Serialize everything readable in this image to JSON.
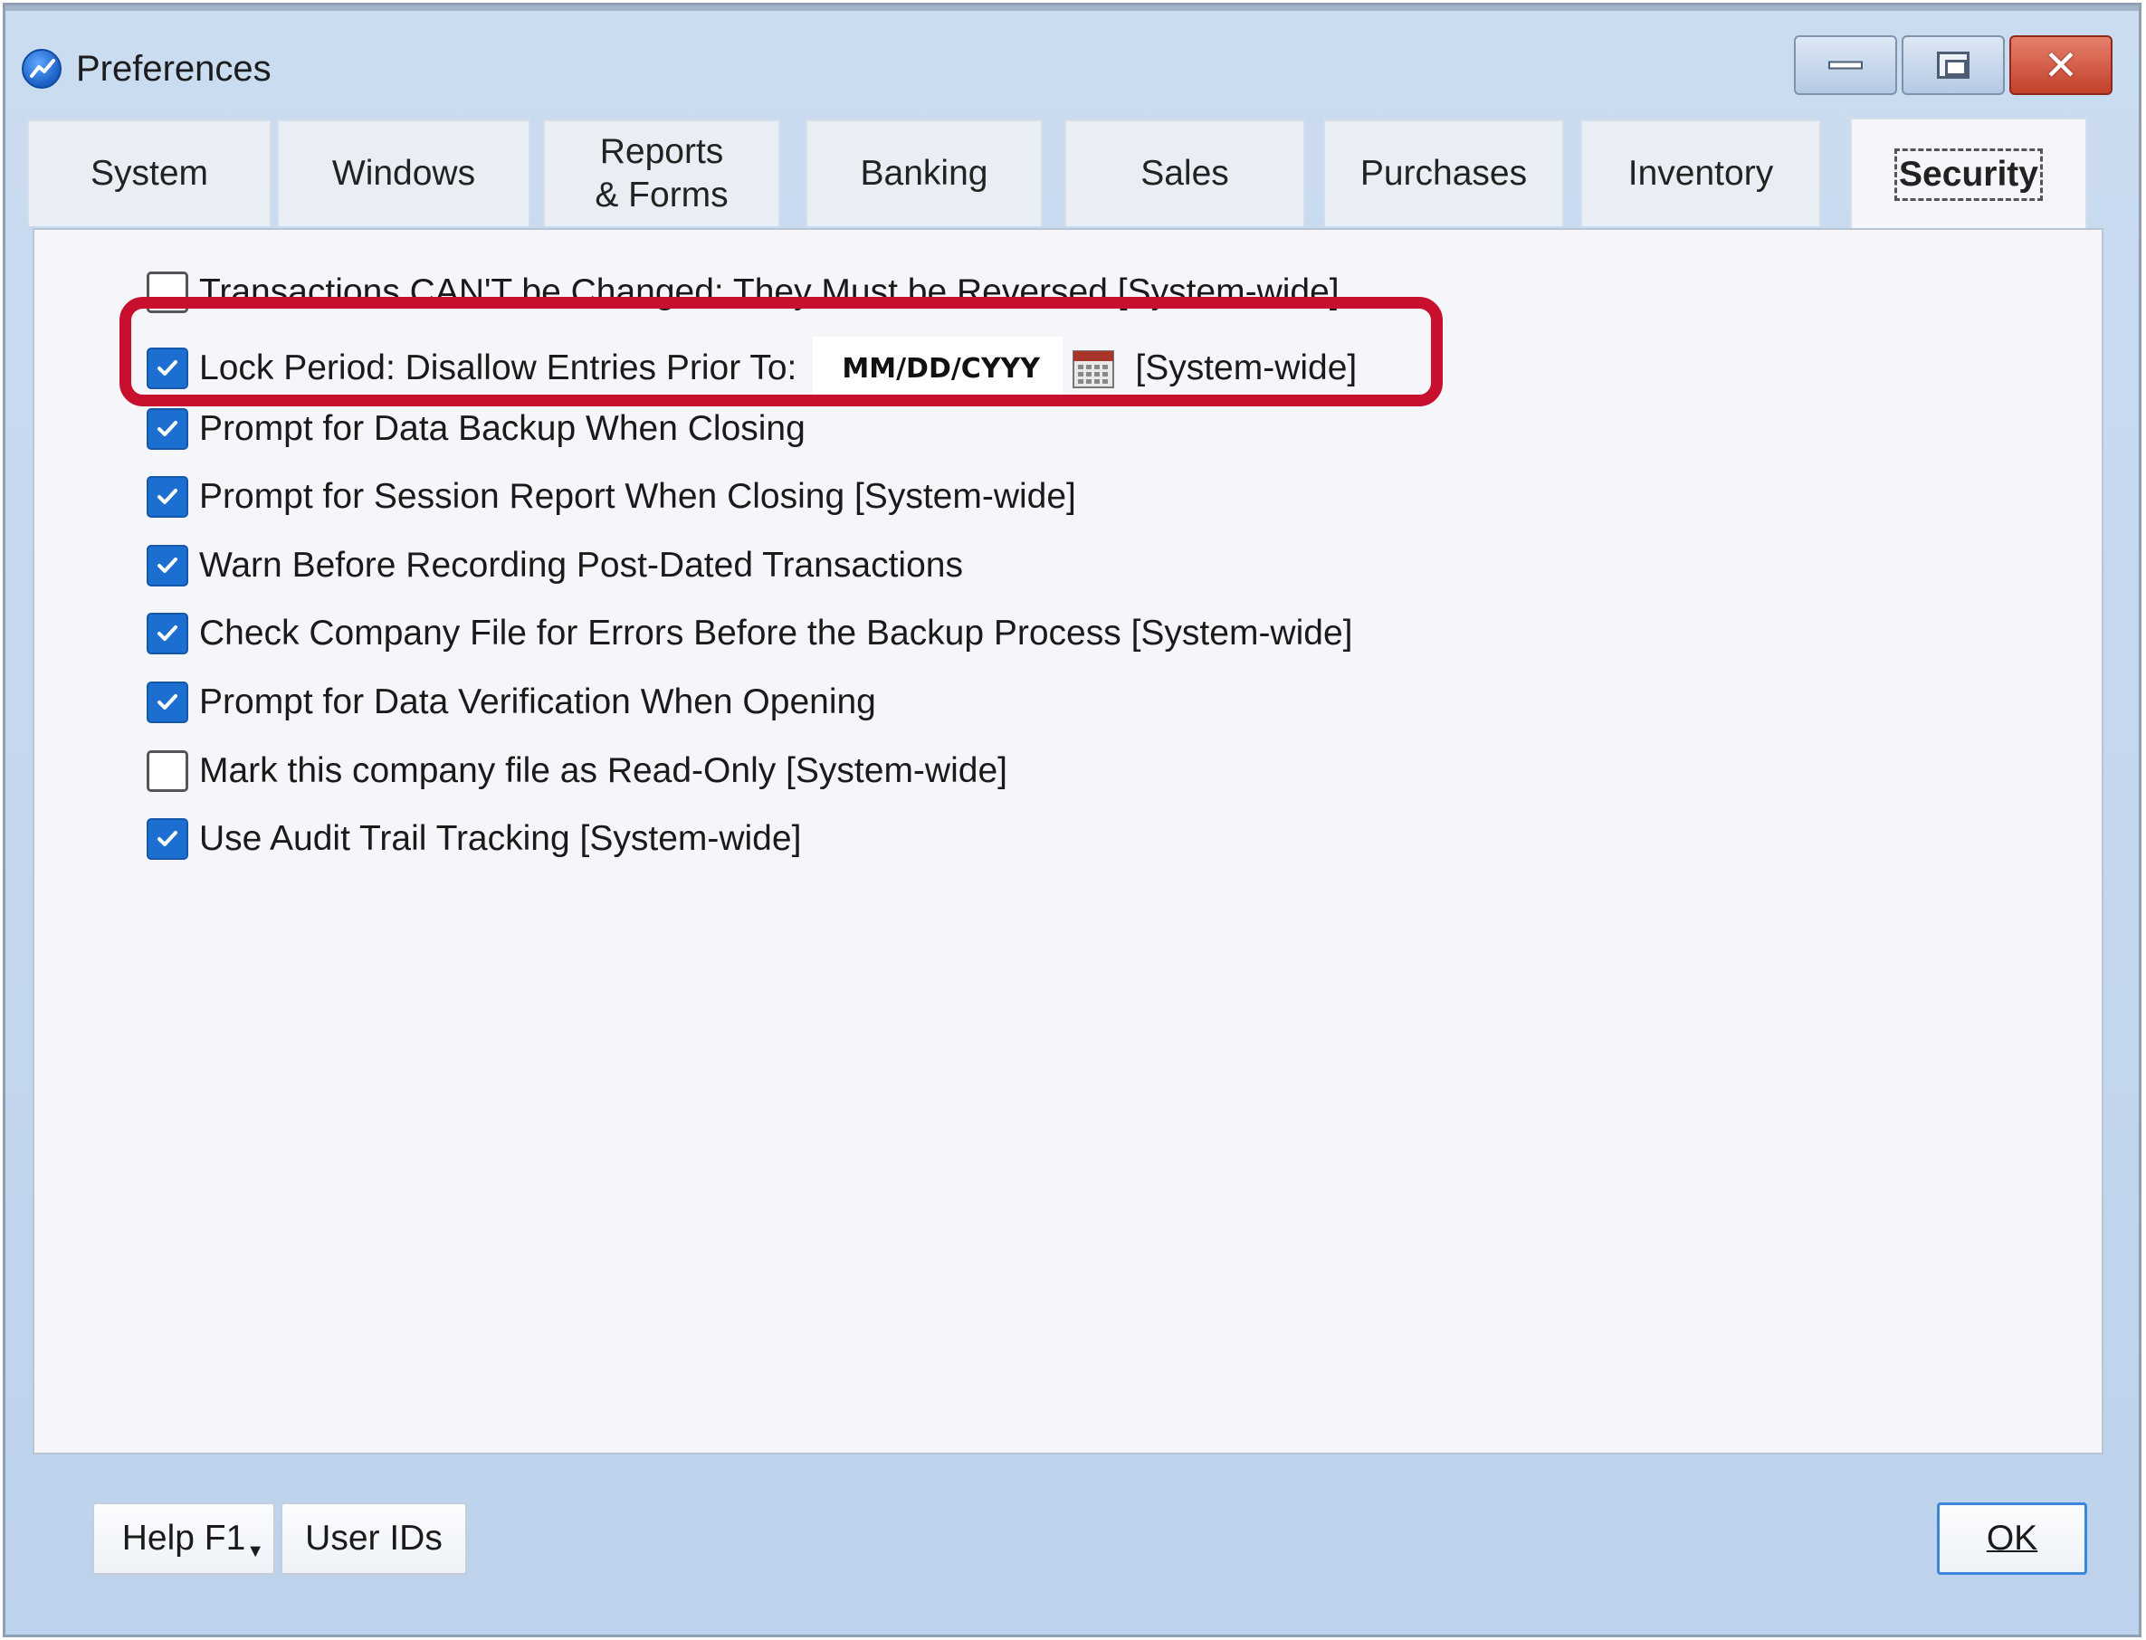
{
  "window": {
    "title": "Preferences"
  },
  "tabs": [
    {
      "label": "System",
      "active": false
    },
    {
      "label": "Windows",
      "active": false
    },
    {
      "label": "Reports\n& Forms",
      "active": false
    },
    {
      "label": "Banking",
      "active": false
    },
    {
      "label": "Sales",
      "active": false
    },
    {
      "label": "Purchases",
      "active": false
    },
    {
      "label": "Inventory",
      "active": false
    },
    {
      "label": "Security",
      "active": true
    }
  ],
  "options": [
    {
      "label": "Transactions CAN'T be Changed: They Must be Reversed [System-wide]",
      "checked": false
    },
    {
      "label": "Lock Period: Disallow Entries Prior To:",
      "checked": true
    },
    {
      "label": "Prompt for Data Backup When Closing",
      "checked": true
    },
    {
      "label": "Prompt for Session Report When Closing [System-wide]",
      "checked": true
    },
    {
      "label": "Warn Before Recording Post-Dated Transactions",
      "checked": true
    },
    {
      "label": "Check Company File for Errors Before the Backup Process [System-wide]",
      "checked": true
    },
    {
      "label": "Prompt for Data Verification When Opening",
      "checked": true
    },
    {
      "label": "Mark this company file as Read-Only [System-wide]",
      "checked": false
    },
    {
      "label": "Use Audit Trail Tracking [System-wide]",
      "checked": true
    }
  ],
  "lock_period": {
    "date_value": "MM/DD/CYYY",
    "suffix": "[System-wide]"
  },
  "buttons": {
    "help": "Help F1",
    "user_ids": "User IDs",
    "ok": "OK"
  },
  "colors": {
    "highlight": "#c8102e",
    "checkbox": "#1c6fd0",
    "close_button": "#c2402b"
  }
}
